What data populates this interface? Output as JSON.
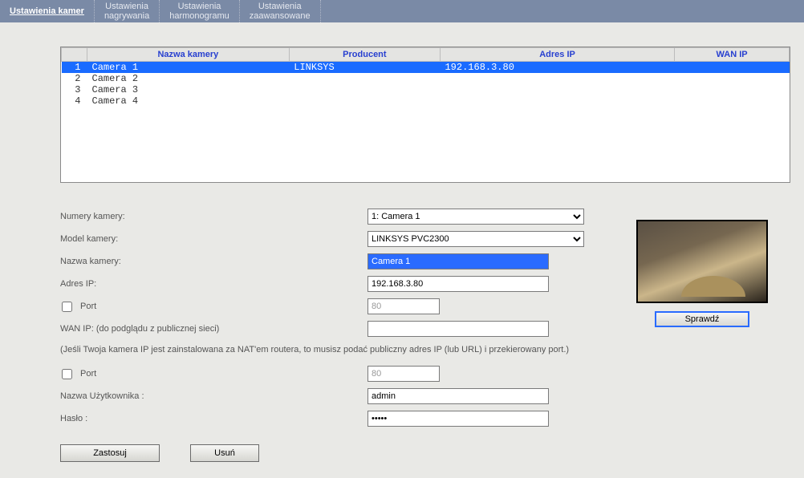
{
  "tabs": [
    {
      "line1": "Ustawienia kamer",
      "line2": ""
    },
    {
      "line1": "Ustawienia",
      "line2": "nagrywania"
    },
    {
      "line1": "Ustawienia",
      "line2": "harmonogramu"
    },
    {
      "line1": "Ustawienia",
      "line2": "zaawansowane"
    }
  ],
  "table": {
    "headers": {
      "name": "Nazwa kamery",
      "vendor": "Producent",
      "ip": "Adres IP",
      "wan": "WAN IP"
    },
    "rows": [
      {
        "n": "1",
        "name": "Camera 1",
        "vendor": "LINKSYS",
        "ip": "192.168.3.80",
        "wan": "",
        "selected": true
      },
      {
        "n": "2",
        "name": "Camera 2",
        "vendor": "",
        "ip": "",
        "wan": "",
        "selected": false
      },
      {
        "n": "3",
        "name": "Camera 3",
        "vendor": "",
        "ip": "",
        "wan": "",
        "selected": false
      },
      {
        "n": "4",
        "name": "Camera 4",
        "vendor": "",
        "ip": "",
        "wan": "",
        "selected": false
      }
    ]
  },
  "form": {
    "number_label": "Numery kamery:",
    "number_value": "1: Camera 1",
    "model_label": "Model kamery:",
    "model_value": "LINKSYS PVC2300",
    "name_label": "Nazwa kamery:",
    "name_value": "Camera 1",
    "ip_label": "Adres IP:",
    "ip_value": "192.168.3.80",
    "port1_label": "Port",
    "port1_value": "80",
    "wan_label": "WAN IP: (do podglądu z publicznej sieci)",
    "wan_value": "",
    "nat_hint": "(Jeśli Twoja kamera IP jest zainstalowana za NAT'em routera, to musisz podać publiczny adres IP (lub URL) i przekierowany port.)",
    "port2_label": "Port",
    "port2_value": "80",
    "user_label": "Nazwa Użytkownika :",
    "user_value": "admin",
    "pass_label": "Hasło :",
    "pass_value": "•••••"
  },
  "preview": {
    "check_label": "Sprawdź"
  },
  "buttons": {
    "apply": "Zastosuj",
    "delete": "Usuń"
  }
}
